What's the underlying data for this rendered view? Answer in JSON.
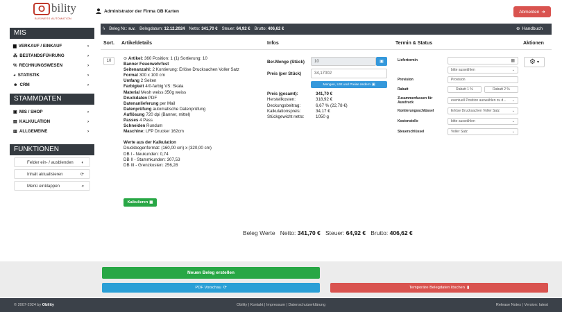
{
  "header": {
    "logo_mark": "O",
    "logo_word": "bility",
    "logo_tagline": "BUSINESS AUTOMATION",
    "admin": "Administrator der Firma OB Karten",
    "logout": "Abmelden"
  },
  "sidebar": {
    "mis_title": "MIS",
    "mis_items": [
      {
        "label": "VERKAUF / EINKAUF"
      },
      {
        "label": "BESTANDSFÜHRUNG"
      },
      {
        "label": "RECHNUNGSWESEN"
      },
      {
        "label": "STATISTIK"
      },
      {
        "label": "CRM"
      }
    ],
    "stamm_title": "STAMMDATEN",
    "stamm_items": [
      {
        "label": "MIS / SHOP"
      },
      {
        "label": "KALKULATION"
      },
      {
        "label": "ALLGEMEINE"
      }
    ],
    "funk_title": "FUNKTIONEN",
    "funk_buttons": [
      {
        "label": "Felder ein- / ausblenden"
      },
      {
        "label": "Inhalt aktualisieren"
      },
      {
        "label": "Menü einklappen"
      }
    ]
  },
  "belegbar": {
    "nr_label": "Beleg Nr.:",
    "nr_value": "n.v.",
    "datum_label": "Belegdatum:",
    "datum_value": "12.12.2024",
    "netto_label": "Netto:",
    "netto_value": "341,70 €",
    "steuer_label": "Steuer:",
    "steuer_value": "64,92 €",
    "brutto_label": "Brutto:",
    "brutto_value": "406,62 €",
    "handbuch": "Handbuch"
  },
  "columns": {
    "sort": "Sort.",
    "artikel": "Artikeldetails",
    "infos": "Infos",
    "termin": "Termin & Status",
    "aktionen": "Aktionen"
  },
  "position": {
    "sort_value": "10",
    "artikel_line_label": "Artikel:",
    "artikel_line_rest": "360  Position: 1 (1)  Sortierung: 10",
    "name": "Banner Feuerwehrfest",
    "details": [
      {
        "k": "Seitenanzahl:",
        "v": "2 Kontierung: Erlöse Drucksachen Voller Satz"
      },
      {
        "k": "Format",
        "v": "300 x 100 cm"
      },
      {
        "k": "Umfang",
        "v": "2 Seiten"
      },
      {
        "k": "Farbigkeit",
        "v": "4/0-farbig VS: Skala"
      },
      {
        "k": "Material",
        "v": "Mesh weiss 350g weiss"
      },
      {
        "k": "Druckdaten",
        "v": "PDF"
      },
      {
        "k": "Datenanlieferung",
        "v": "per Mail"
      },
      {
        "k": "Datenprüfung",
        "v": "automatische Datenprüfung"
      },
      {
        "k": "Auflösung",
        "v": "720 dpi (Banner, mittel)"
      },
      {
        "k": "Passes",
        "v": "4 Pass"
      },
      {
        "k": "Schneiden",
        "v": "Rundum"
      },
      {
        "k": "Maschine:",
        "v": "LFP Drucker 162cm"
      }
    ],
    "kalk_title": "Werte aus der Kalkulation",
    "kalk_lines": [
      "Druckbogenformat: (160,00 cm) x (320,00 cm)",
      "DB I - Neukunden: 0,74",
      "DB II - Stammkunden: 307,53",
      "DB III - Grenzkosten: 256,28"
    ],
    "kalk_button": "Kalkulieren"
  },
  "infos": {
    "menge_label": "Ber.Menge (Stück)",
    "menge_value": "10",
    "preis_label": "Preis (per Stück)",
    "preis_value": "34,17002",
    "recalc_button": "Mengen, USt und Preise ändern",
    "rows": [
      {
        "k": "Preis (gesamt):",
        "v": "341,70 €",
        "bold": true
      },
      {
        "k": "Herstellkosten:",
        "v": "318,92 €"
      },
      {
        "k": "Deckungsbeitrag:",
        "v": "6,67 % (22,78 €)"
      },
      {
        "k": "Kalkulationspreis:",
        "v": "34,17 €"
      },
      {
        "k": "Stückgewicht netto:",
        "v": "1050 g"
      }
    ]
  },
  "termin": {
    "liefertermin_label": "Liefertermin",
    "liefertermin_select": "bitte auswählen",
    "provision_label": "Provision",
    "provision_placeholder": "Provision",
    "rabatt_label": "Rabatt",
    "rabatt1": "Rabatt 1 %",
    "rabatt2": "Rabatt 2 %",
    "zusammen_label": "Zusammenfassen für Ausdruck",
    "zusammen_select": "eventuell Position auswählen zu d...",
    "konto_label": "Kontierungsschlüssel",
    "konto_select": "Erlöse Drucksachen Voller Satz",
    "kosten_label": "Kostenstelle",
    "kosten_select": "bitte auswählen",
    "steuer_label": "Steuerschlüssel",
    "steuer_select": "Voller Satz"
  },
  "summary": {
    "label": "Beleg Werte",
    "netto_label": "Netto:",
    "netto_value": "341,70 €",
    "steuer_label": "Steuer:",
    "steuer_value": "64,92 €",
    "brutto_label": "Brutto:",
    "brutto_value": "406,62 €"
  },
  "actions": {
    "new_beleg": "Neuen Beleg erstellen",
    "pdf": "PDF Vorschau",
    "tmp_delete": "Temporäre Belegdaten löschen"
  },
  "footer": {
    "copyright_prefix": "© 2007-2024 by",
    "copyright_brand": "Obility",
    "links": "Obility | Kontakt | Impressum | Datenschutzerklärung",
    "release": "Release Notes | Version: latest"
  },
  "colors": {
    "dark": "#3b4149",
    "green": "#28a745",
    "blue": "#2a9fd6",
    "red": "#d9534f"
  }
}
